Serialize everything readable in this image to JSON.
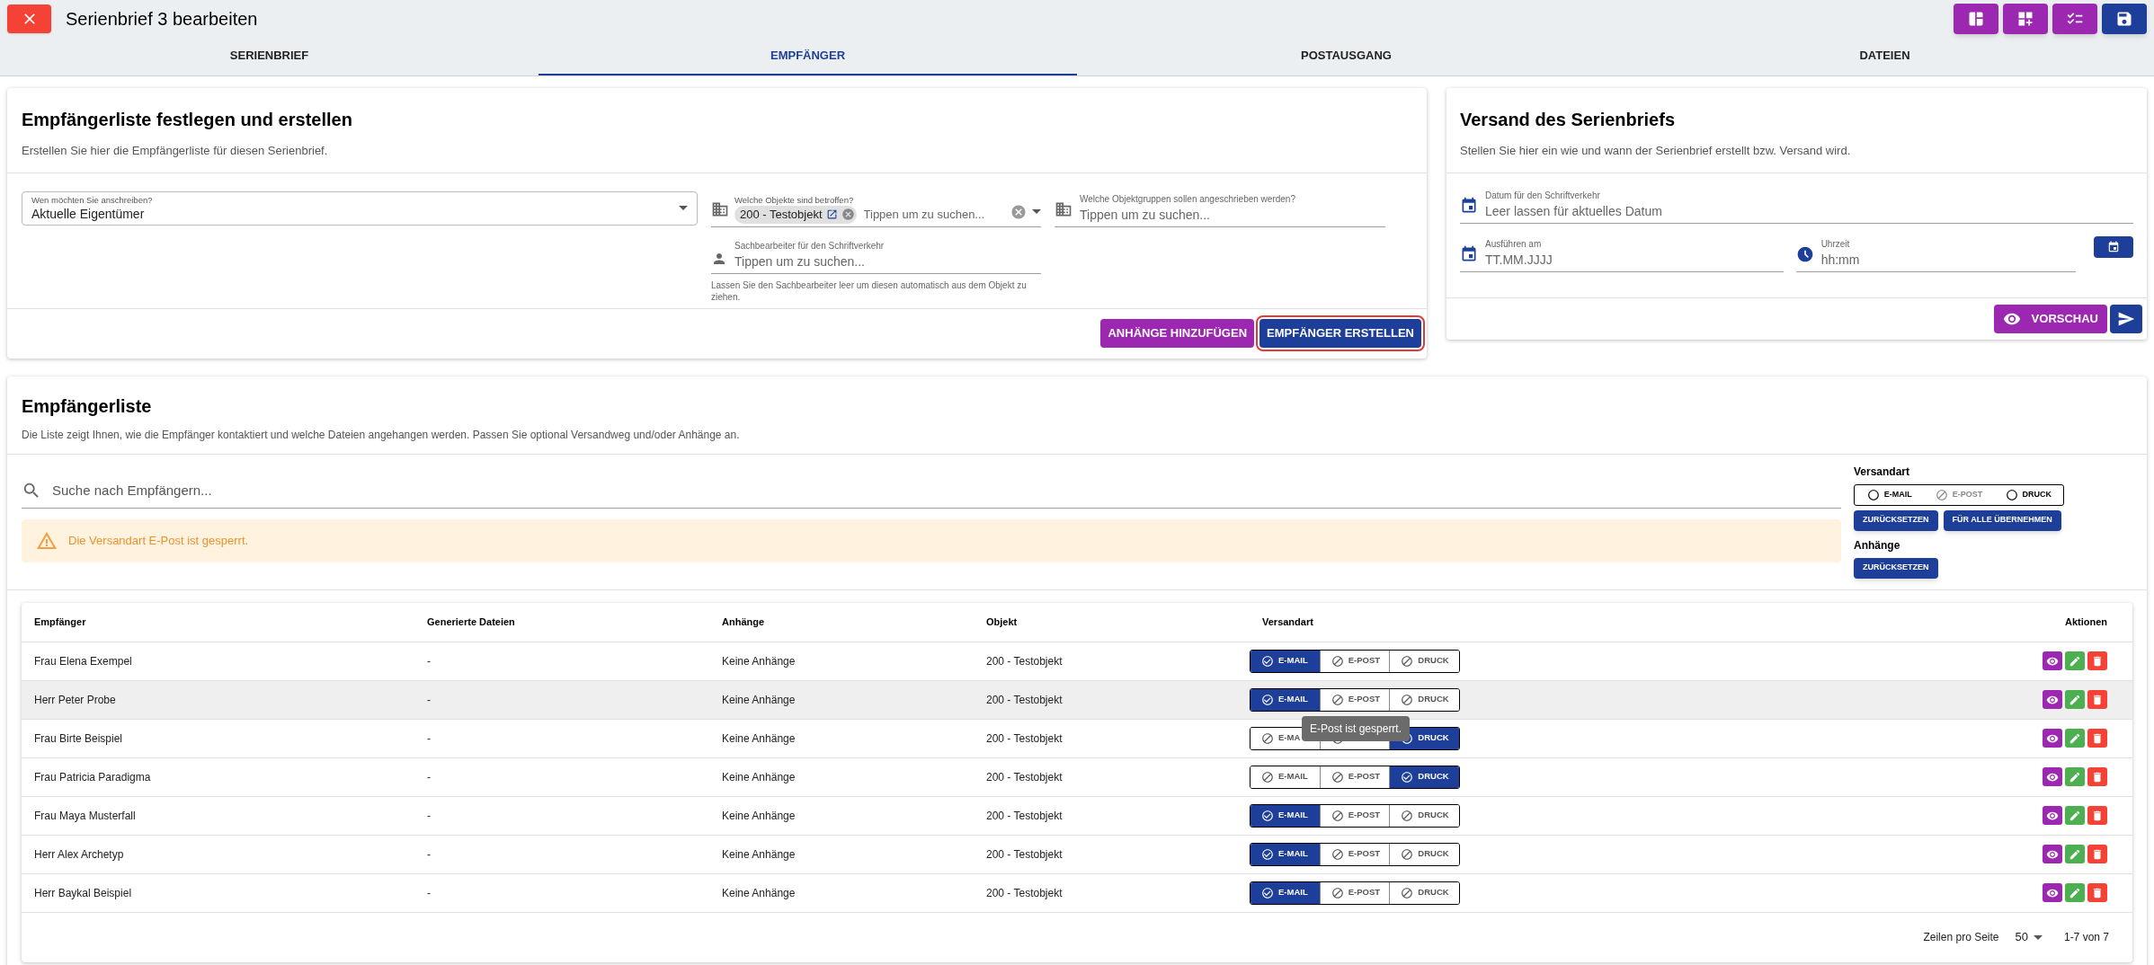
{
  "header": {
    "title": "Serienbrief 3 bearbeiten"
  },
  "tabs": [
    {
      "label": "SERIENBRIEF",
      "selected": false
    },
    {
      "label": "EMPFÄNGER",
      "selected": true
    },
    {
      "label": "POSTAUSGANG",
      "selected": false
    },
    {
      "label": "DATEIEN",
      "selected": false
    }
  ],
  "recipients_setup": {
    "title": "Empfängerliste festlegen und erstellen",
    "subtitle": "Erstellen Sie hier die Empfängerliste für diesen Serienbrief.",
    "audience": {
      "label": "Wen möchten Sie anschreiben?",
      "value": "Aktuelle Eigentümer"
    },
    "objects": {
      "label": "Welche Objekte sind betroffen?",
      "chip": "200 - Testobjekt",
      "placeholder": "Tippen um zu suchen..."
    },
    "object_groups": {
      "label": "Welche Objektgruppen sollen angeschrieben werden?",
      "placeholder": "Tippen um zu suchen..."
    },
    "clerk": {
      "label": "Sachbearbeiter für den Schriftverkehr",
      "placeholder": "Tippen um zu suchen...",
      "helper": "Lassen Sie den Sachbearbeiter leer um diesen automatisch aus dem Objekt zu ziehen."
    },
    "buttons": [
      {
        "label": "ANHÄNGE HINZUFÜGEN",
        "kind": "secondary",
        "focused": false
      },
      {
        "label": "EMPFÄNGER ERSTELLEN",
        "kind": "primary",
        "focused": true
      }
    ]
  },
  "shipping": {
    "title": "Versand des Serienbriefs",
    "subtitle": "Stellen Sie hier ein wie und wann der Serienbrief erstellt bzw. Versand wird.",
    "date": {
      "label": "Datum für den Schriftverkehr",
      "placeholder": "Leer lassen für aktuelles Datum"
    },
    "run_date": {
      "label": "Ausführen am",
      "placeholder": "TT.MM.JJJJ"
    },
    "time": {
      "label": "Uhrzeit",
      "placeholder": "hh:mm"
    },
    "preview_button": "VORSCHAU"
  },
  "recipient_list": {
    "title": "Empfängerliste",
    "subtitle": "Die Liste zeigt Ihnen, wie die Empfänger kontaktiert und welche Dateien angehangen werden. Passen Sie optional Versandweg und/oder Anhänge an.",
    "search": {
      "placeholder": "Suche nach Empfängern..."
    },
    "alert": "Die Versandart E-Post ist gesperrt.",
    "shipping_type": {
      "heading": "Versandart",
      "options": [
        {
          "label": "E-MAIL",
          "disabled": false
        },
        {
          "label": "E-POST",
          "disabled": true
        },
        {
          "label": "DRUCK",
          "disabled": false
        }
      ],
      "buttons": [
        "ZURÜCKSETZEN",
        "FÜR ALLE ÜBERNEHMEN"
      ]
    },
    "attachments": {
      "heading": "Anhänge",
      "buttons": [
        "ZURÜCKSETZEN"
      ]
    },
    "table": {
      "columns": [
        "Empfänger",
        "Generierte Dateien",
        "Anhänge",
        "Objekt",
        "Versandart",
        "Aktionen"
      ],
      "rows": [
        {
          "recipient": "Frau Elena Exempel",
          "files": "-",
          "attachments": "Keine Anhänge",
          "object": "200 - Testobjekt",
          "hovered": false,
          "shipping": [
            {
              "label": "E-MAIL",
              "selected": true
            },
            {
              "label": "E-POST",
              "selected": false
            },
            {
              "label": "DRUCK",
              "selected": false
            }
          ]
        },
        {
          "recipient": "Herr Peter Probe",
          "files": "-",
          "attachments": "Keine Anhänge",
          "object": "200 - Testobjekt",
          "hovered": true,
          "shipping": [
            {
              "label": "E-MAIL",
              "selected": true
            },
            {
              "label": "E-POST",
              "selected": false
            },
            {
              "label": "DRUCK",
              "selected": false
            }
          ]
        },
        {
          "recipient": "Frau Birte Beispiel",
          "files": "-",
          "attachments": "Keine Anhänge",
          "object": "200 - Testobjekt",
          "hovered": false,
          "tooltip": "E-Post ist gesperrt.",
          "shipping": [
            {
              "label": "E-MA",
              "selected": false
            },
            {
              "selected": false
            },
            {
              "label": "DRUCK",
              "selected": true
            }
          ]
        },
        {
          "recipient": "Frau Patricia Paradigma",
          "files": "-",
          "attachments": "Keine Anhänge",
          "object": "200 - Testobjekt",
          "hovered": false,
          "shipping": [
            {
              "label": "E-MAIL",
              "selected": false
            },
            {
              "label": "E-POST",
              "selected": false
            },
            {
              "label": "DRUCK",
              "selected": true
            }
          ]
        },
        {
          "recipient": "Frau Maya Musterfall",
          "files": "-",
          "attachments": "Keine Anhänge",
          "object": "200 - Testobjekt",
          "hovered": false,
          "shipping": [
            {
              "label": "E-MAIL",
              "selected": true
            },
            {
              "label": "E-POST",
              "selected": false
            },
            {
              "label": "DRUCK",
              "selected": false
            }
          ]
        },
        {
          "recipient": "Herr Alex Archetyp",
          "files": "-",
          "attachments": "Keine Anhänge",
          "object": "200 - Testobjekt",
          "hovered": false,
          "shipping": [
            {
              "label": "E-MAIL",
              "selected": true
            },
            {
              "label": "E-POST",
              "selected": false
            },
            {
              "label": "DRUCK",
              "selected": false
            }
          ]
        },
        {
          "recipient": "Herr Baykal Beispiel",
          "files": "-",
          "attachments": "Keine Anhänge",
          "object": "200 - Testobjekt",
          "hovered": false,
          "shipping": [
            {
              "label": "E-MAIL",
              "selected": true
            },
            {
              "label": "E-POST",
              "selected": false
            },
            {
              "label": "DRUCK",
              "selected": false
            }
          ]
        }
      ]
    },
    "pagination": {
      "rows_per_page_label": "Zeilen pro Seite",
      "rows_per_page": "50",
      "range": "1-7 von 7"
    }
  }
}
